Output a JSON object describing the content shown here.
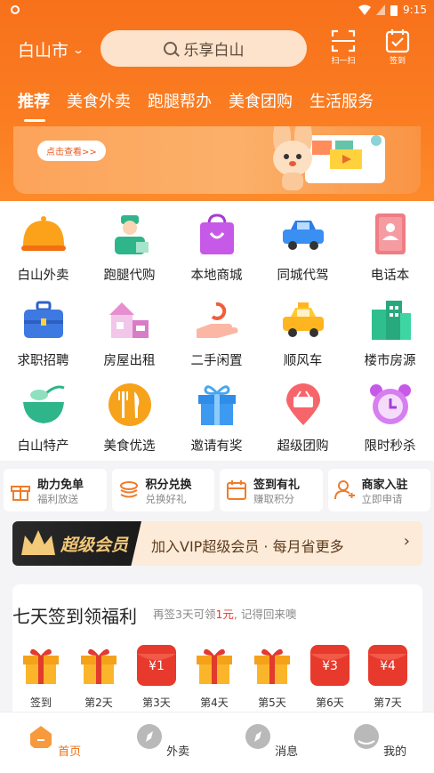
{
  "statusbar": {
    "time": "9:15",
    "battery": "8"
  },
  "header": {
    "city": "白山市",
    "search_placeholder": "乐享白山",
    "scan_label": "扫一扫",
    "checkin_label": "签到"
  },
  "tabs": [
    "推荐",
    "美食外卖",
    "跑腿帮办",
    "美食团购",
    "生活服务"
  ],
  "banner": {
    "button_label": "点击查看>>"
  },
  "grid": [
    {
      "label": "白山外卖",
      "icon": "food-cover-icon"
    },
    {
      "label": "跑腿代购",
      "icon": "courier-icon"
    },
    {
      "label": "本地商城",
      "icon": "shopping-bag-icon"
    },
    {
      "label": "同城代驾",
      "icon": "car-icon"
    },
    {
      "label": "电话本",
      "icon": "phonebook-icon"
    },
    {
      "label": "求职招聘",
      "icon": "briefcase-icon"
    },
    {
      "label": "房屋出租",
      "icon": "house-icon"
    },
    {
      "label": "二手闲置",
      "icon": "hand-recycle-icon"
    },
    {
      "label": "顺风车",
      "icon": "taxi-icon"
    },
    {
      "label": "楼市房源",
      "icon": "building-icon"
    },
    {
      "label": "白山特产",
      "icon": "bowl-icon"
    },
    {
      "label": "美食优选",
      "icon": "fork-knife-icon"
    },
    {
      "label": "邀请有奖",
      "icon": "gift-icon"
    },
    {
      "label": "超级团购",
      "icon": "location-basket-icon"
    },
    {
      "label": "限时秒杀",
      "icon": "alarm-clock-icon"
    }
  ],
  "quick": [
    {
      "title": "助力免单",
      "sub": "福利放送",
      "icon": "gift-box-icon"
    },
    {
      "title": "积分兑换",
      "sub": "兑换好礼",
      "icon": "coins-icon"
    },
    {
      "title": "签到有礼",
      "sub": "赚取积分",
      "icon": "calendar-icon"
    },
    {
      "title": "商家入驻",
      "sub": "立即申请",
      "icon": "merchant-icon"
    }
  ],
  "vip": {
    "title": "超级会员",
    "text": "加入VIP超级会员 · 每月省更多"
  },
  "signin": {
    "title": "七天签到领福利",
    "sub_prefix": "再签3天可领",
    "sub_amount": "1元",
    "sub_suffix": ", 记得回来噢",
    "days": [
      {
        "label": "签到",
        "type": "gift"
      },
      {
        "label": "第2天",
        "type": "gift"
      },
      {
        "label": "第3天",
        "type": "redpacket",
        "amount": "¥1"
      },
      {
        "label": "第4天",
        "type": "gift"
      },
      {
        "label": "第5天",
        "type": "gift"
      },
      {
        "label": "第6天",
        "type": "redpacket",
        "amount": "¥3"
      },
      {
        "label": "第7天",
        "type": "redpacket",
        "amount": "¥4"
      }
    ]
  },
  "bottom_nav": [
    "首页",
    "外卖",
    "消息",
    "我的"
  ],
  "colors": {
    "brand": "#f7711b",
    "red": "#e23a2c"
  }
}
